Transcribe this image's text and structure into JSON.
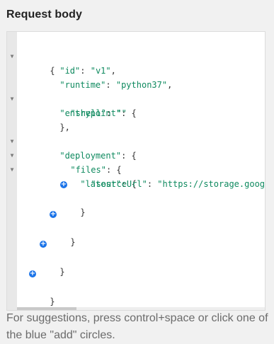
{
  "heading": "Request body",
  "editor": {
    "fold_icon": "triangle-down",
    "add_icon": "plus-circle",
    "accent_color": "#1a73e8",
    "lines": {
      "l0": {
        "text": "{"
      },
      "l1": {
        "key": "\"id\"",
        "sep": ": ",
        "val": "\"v1\"",
        "tail": ","
      },
      "l2": {
        "key": "\"runtime\"",
        "sep": ": ",
        "val": "\"python37\"",
        "tail": ","
      },
      "l3": {
        "key": "\"entrypoint\"",
        "sep": ": ",
        "tail": "{"
      },
      "l4": {
        "key": "\"shell\"",
        "sep": ": ",
        "val": "\"\""
      },
      "l5": {
        "text": "},"
      },
      "l6": {
        "key": "\"deployment\"",
        "sep": ": ",
        "tail": "{"
      },
      "l7": {
        "key": "\"files\"",
        "sep": ": ",
        "tail": "{"
      },
      "l8": {
        "key": "\"latest\"",
        "sep": ": ",
        "tail": "{"
      },
      "l9": {
        "key": "\"sourceUrl\"",
        "sep": ": ",
        "val": "\"https://storage.googleapis"
      },
      "l10": {
        "text": "}"
      },
      "l11": {
        "text": "}"
      },
      "l12": {
        "text": "}"
      },
      "l13": {
        "text": "}"
      }
    }
  },
  "hint": "For suggestions, press control+space or click one of the blue \"add\" circles."
}
